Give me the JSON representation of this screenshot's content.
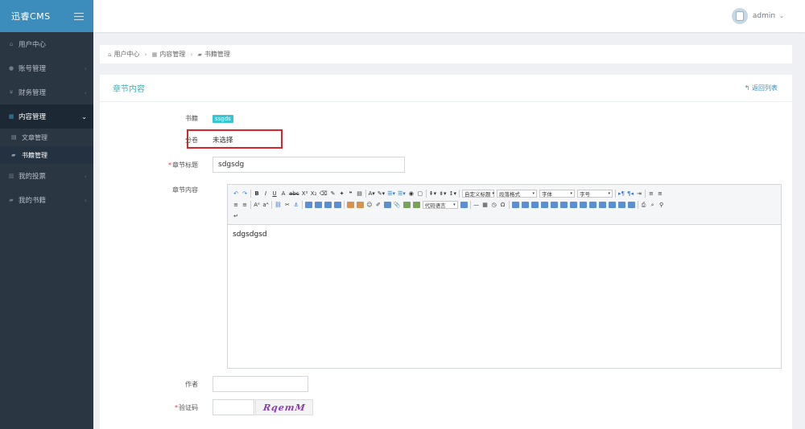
{
  "brand": {
    "title": "迅睿CMS"
  },
  "sidebar": {
    "items": [
      {
        "label": "用户中心",
        "icon": "home-icon"
      },
      {
        "label": "账号管理",
        "icon": "user-icon"
      },
      {
        "label": "财务管理",
        "icon": "yen-icon"
      },
      {
        "label": "内容管理",
        "icon": "grid-icon"
      },
      {
        "label": "我的投票",
        "icon": "bar-chart-icon"
      },
      {
        "label": "我的书籍",
        "icon": "book-icon"
      }
    ],
    "sub_items": [
      {
        "label": "文章管理"
      },
      {
        "label": "书籍管理"
      }
    ]
  },
  "header": {
    "username": "admin"
  },
  "breadcrumb": {
    "items": [
      "用户中心",
      "内容管理",
      "书籍管理"
    ]
  },
  "panel": {
    "title": "章节内容",
    "back_label": "返回列表"
  },
  "form": {
    "book_label": "书籍",
    "book_value": "ssgds",
    "volume_label": "分卷",
    "volume_value": "未选择",
    "chapter_title_label": "章节标题",
    "chapter_title_value": "sdgsdg",
    "content_label": "章节内容",
    "content_value": "sdgsdgsd",
    "author_label": "作者",
    "author_value": "",
    "captcha_label": "验证码",
    "captcha_text": "RqemM"
  },
  "editor": {
    "selects": {
      "custom_title": "自定义标题",
      "paragraph": "段落格式",
      "font": "字体",
      "size": "字号",
      "code_lang": "代码语言"
    }
  },
  "colors": {
    "sidebar_bg": "#2b3643",
    "brand_bg": "#3c8dbc",
    "title_teal": "#3cb4b4",
    "highlight_red": "#d9262d"
  }
}
